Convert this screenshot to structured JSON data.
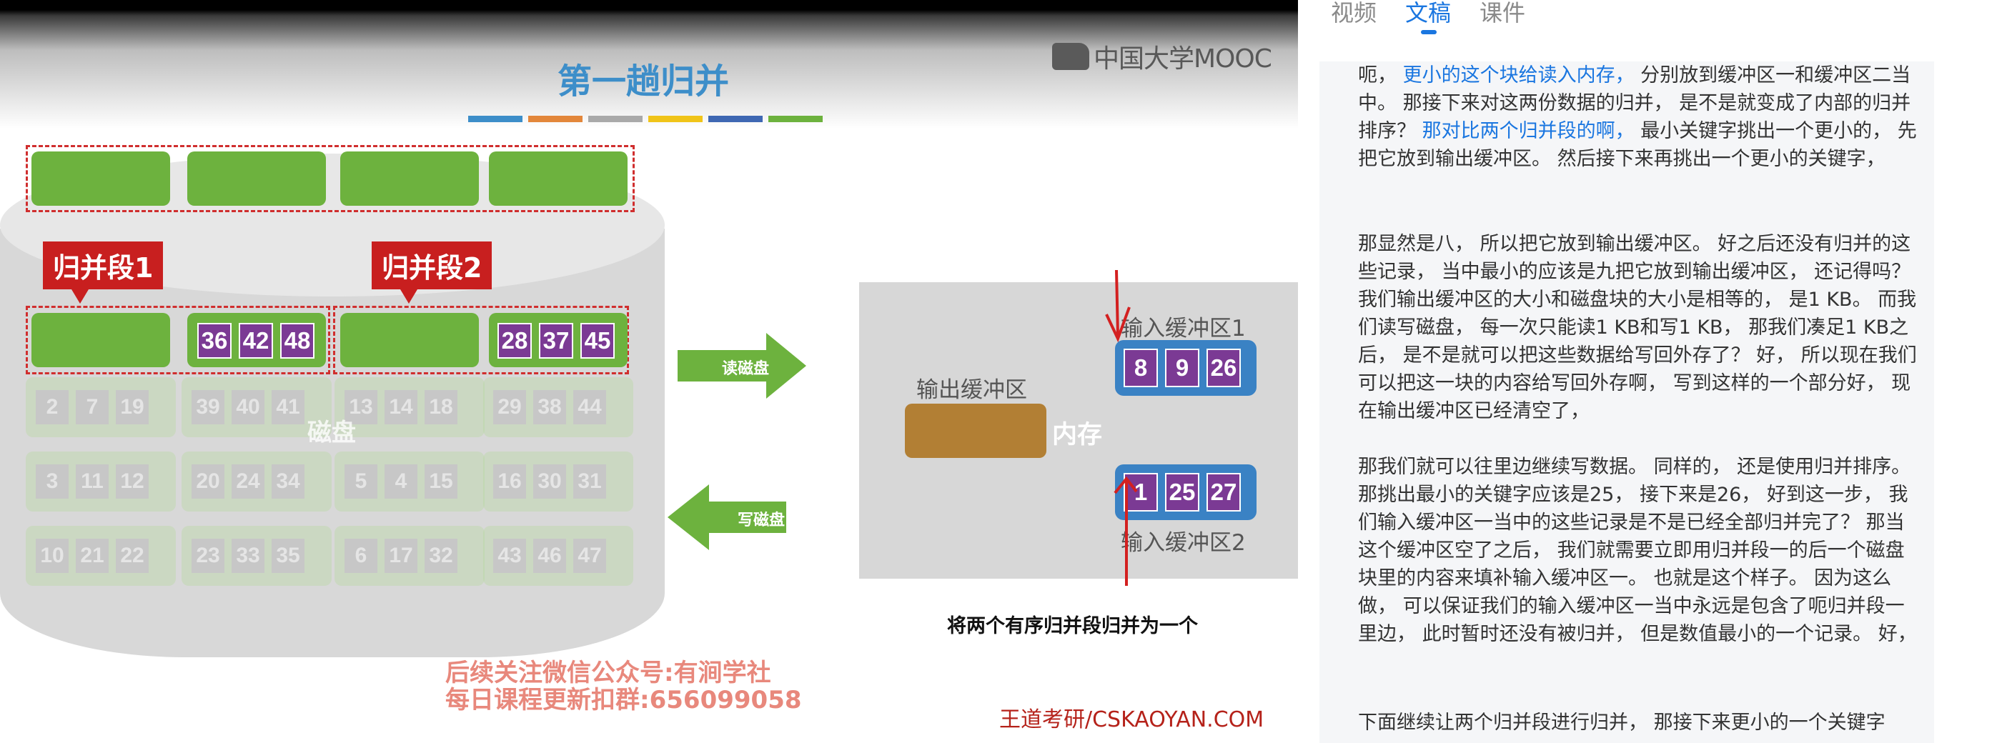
{
  "slide": {
    "title": "第一趟归并",
    "logo_text": "中国大学MOOC",
    "colorbar": [
      "#3d8ec9",
      "#e3873b",
      "#a9a9a9",
      "#f0c419",
      "#3f68b3",
      "#6db23e"
    ],
    "segment1_label": "归并段1",
    "segment2_label": "归并段2",
    "disk_label": "磁盘",
    "seg1_block_values": [
      "36",
      "42",
      "48"
    ],
    "seg2_block_values": [
      "28",
      "37",
      "45"
    ],
    "faded_rows": [
      [
        [
          "2",
          "7",
          "19"
        ],
        [
          "39",
          "40",
          "41"
        ],
        [
          "13",
          "14",
          "18"
        ],
        [
          "29",
          "38",
          "44"
        ]
      ],
      [
        [
          "3",
          "11",
          "12"
        ],
        [
          "20",
          "24",
          "34"
        ],
        [
          "5",
          "4",
          "15"
        ],
        [
          "16",
          "30",
          "31"
        ]
      ],
      [
        [
          "10",
          "21",
          "22"
        ],
        [
          "23",
          "33",
          "35"
        ],
        [
          "6",
          "17",
          "32"
        ],
        [
          "43",
          "46",
          "47"
        ]
      ]
    ],
    "read_arrow_label": "读磁盘",
    "write_arrow_label": "写磁盘",
    "output_buffer_label": "输出缓冲区",
    "memory_label": "内存",
    "input_buffer1_label": "输入缓冲区1",
    "input_buffer2_label": "输入缓冲区2",
    "input_buffer1_values": [
      "8",
      "9",
      "26"
    ],
    "input_buffer2_values": [
      "1",
      "25",
      "27"
    ],
    "caption": "将两个有序归并段归并为一个",
    "watermark_line1": "后续关注微信公众号:有涧学社",
    "watermark_line2": "每日课程更新扣群:656099058",
    "footer": "王道考研/CSKAOYAN.COM"
  },
  "panel": {
    "tabs": [
      {
        "label": "视频",
        "active": false
      },
      {
        "label": "文稿",
        "active": true
      },
      {
        "label": "课件",
        "active": false
      }
    ],
    "paragraphs": [
      {
        "segments": [
          {
            "text": "呃， ",
            "highlight": false
          },
          {
            "text": "更小的这个块给读入内存，",
            "highlight": true
          },
          {
            "text": " 分别放到缓冲区一和缓冲区二当中。 那接下来对这两份数据的归并， 是不是就变成了内部的归并排序？ ",
            "highlight": false
          },
          {
            "text": "那对比两个归并段的啊，",
            "highlight": true
          },
          {
            "text": " 最小关键字挑出一个更小的， 先把它放到输出缓冲区。 然后接下来再挑出一个更小的关键字，",
            "highlight": false
          }
        ]
      },
      {
        "segments": [
          {
            "text": "那显然是八， 所以把它放到输出缓冲区。 好之后还没有归并的这些记录， 当中最小的应该是九把它放到输出缓冲区， 还记得吗？ 我们输出缓冲区的大小和磁盘块的大小是相等的， 是1 KB。 而我们读写磁盘， 每一次只能读1 KB和写1 KB， 那我们凑足1 KB之后， 是不是就可以把这些数据给写回外存了？ 好， 所以现在我们可以把这一块的内容给写回外存啊， 写到这样的一个部分好， 现在输出缓冲区已经清空了，",
            "highlight": false
          }
        ]
      },
      {
        "segments": [
          {
            "text": "那我们就可以往里边继续写数据。 同样的， 还是使用归并排序。 那挑出最小的关键字应该是25， 接下来是26， 好到这一步， 我们输入缓冲区一当中的这些记录是不是已经全部归并完了？ 那当这个缓冲区空了之后， 我们就需要立即用归并段一的后一个磁盘块里的内容来填补输入缓冲区一。 也就是这个样子。 因为这么做， 可以保证我们的输入缓冲区一当中永远是包含了呃归并段一里边， 此时暂时还没有被归并， 但是数值最小的一个记录。 好，",
            "highlight": false
          }
        ]
      },
      {
        "segments": [
          {
            "text": "下面继续让两个归并段进行归并， 那接下来更小的一个关键字",
            "highlight": false
          }
        ]
      }
    ]
  }
}
